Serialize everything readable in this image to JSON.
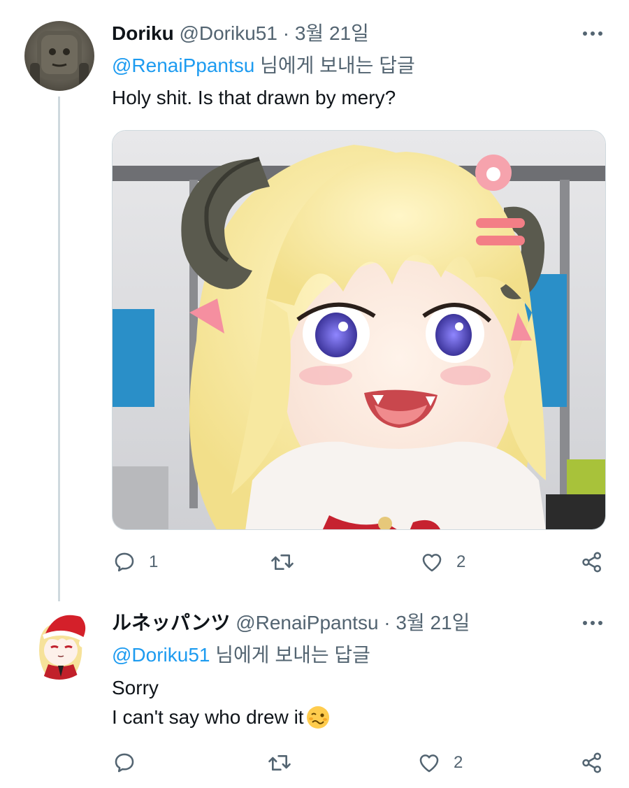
{
  "tweets": [
    {
      "name": "Doriku",
      "handle": "@Doriku51",
      "separator": "·",
      "date": "3월 21일",
      "reply_to_handle": "@RenaiPpantsu",
      "reply_suffix": " 님에게 보내는 답글",
      "text_lines": [
        "Holy shit. Is that drawn by mery?"
      ],
      "media_icon": "anime-girl-with-ram-horns-image",
      "stats": {
        "replies": "1",
        "retweets": "",
        "likes": "2"
      }
    },
    {
      "name": "ルネッパンツ",
      "handle": "@RenaiPpantsu",
      "separator": "·",
      "date": "3월 21일",
      "reply_to_handle": "@Doriku51",
      "reply_suffix": " 님에게 보내는 답글",
      "text_lines": [
        "Sorry",
        "I can't say who drew it"
      ],
      "emoji": "🥴",
      "stats": {
        "replies": "",
        "retweets": "",
        "likes": "2"
      }
    }
  ],
  "colors": {
    "accent": "#1d9bf0",
    "secondary_text": "#536471",
    "primary_text": "#0f1419",
    "thread_line": "#cfd9de"
  },
  "icons": [
    "more-icon",
    "reply-icon",
    "retweet-icon",
    "like-icon",
    "share-icon"
  ]
}
